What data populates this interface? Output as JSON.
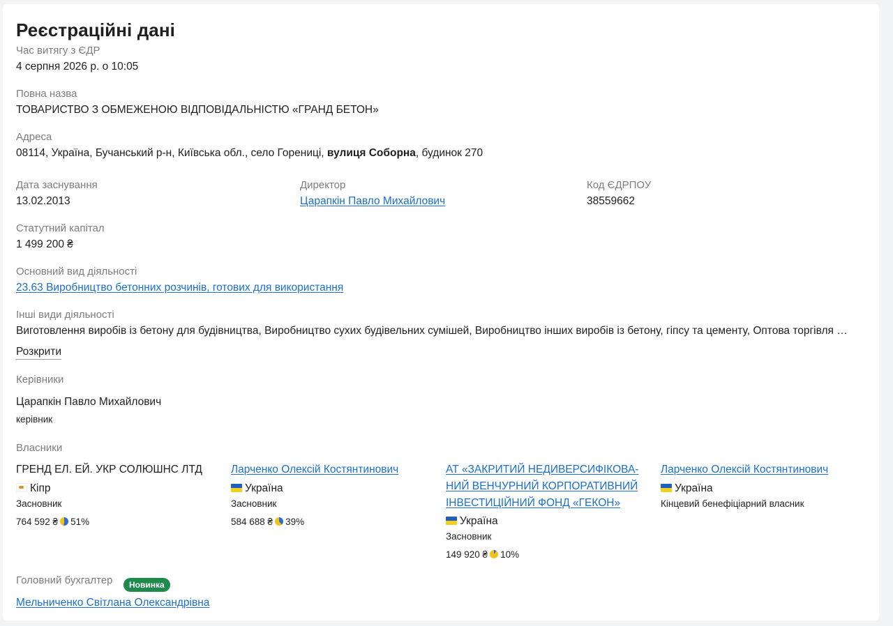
{
  "page": {
    "title": "Реєстраційні дані"
  },
  "extract_time": {
    "label": "Час витягу з ЄДР",
    "value": "4 серпня 2026 р. о 10:05"
  },
  "full_name": {
    "label": "Повна назва",
    "value": "ТОВАРИСТВО З ОБМЕЖЕНОЮ ВІДПОВІДАЛЬНІСТЮ «ГРАНД БЕТОН»"
  },
  "address": {
    "label": "Адреса",
    "prefix": "08114, Україна, Бучанський р-н, Київська обл., село Горениці, ",
    "street": "вулиця Соборна",
    "suffix": ", будинок 270"
  },
  "founded": {
    "label": "Дата заснування",
    "value": "13.02.2013"
  },
  "director": {
    "label": "Директор",
    "value": "Царапкін Павло Михайлович"
  },
  "edrpou": {
    "label": "Код ЄДРПОУ",
    "value": "38559662"
  },
  "capital": {
    "label": "Статутний капітал",
    "value": "1 499 200 ₴"
  },
  "main_activity": {
    "label": "Основний вид діяльності",
    "value": "23.63 Виробництво бетонних розчинів, готових для використання"
  },
  "other_activities": {
    "label": "Інші види діяльності",
    "value": "Виготовлення виробів із бетону для будівництва, Виробництво сухих будівельних сумішей, Виробництво інших виробів із бетону, гіпсу та цементу, Оптова торгівля …",
    "expand_label": "Розкрити"
  },
  "managers": {
    "label": "Керівники",
    "items": [
      {
        "name": "Царапкін Павло Михайлович",
        "role": "керівник"
      }
    ]
  },
  "owners": {
    "label": "Власники",
    "items": [
      {
        "name": "ГРЕНД ЕЛ. ЕЙ. УКР СОЛЮШНС ЛТД",
        "country": "Кіпр",
        "role": "Засновник",
        "amount": "764 592 ₴",
        "share": "51%",
        "share_fraction": 0.51
      },
      {
        "name": "Ларченко Олексій Костянтинович",
        "country": "Україна",
        "role": "Засновник",
        "amount": "584 688 ₴",
        "share": "39%",
        "share_fraction": 0.39
      },
      {
        "name_line1": "АТ «ЗАКРИТИЙ НЕДИВЕРСИФІКОВА-",
        "name_line2": "НИЙ ВЕНЧУРНИЙ КОРПОРАТИВНИЙ",
        "name_line3": "ІНВЕСТИЦІЙНИЙ ФОНД «ГЕКОН»",
        "country": "Україна",
        "role": "Засновник",
        "amount": "149 920 ₴",
        "share": "10%",
        "share_fraction": 0.1
      },
      {
        "name": "Ларченко Олексій Костянтинович",
        "country": "Україна",
        "role": "Кінцевий бенефіціарний власник"
      }
    ]
  },
  "chief_accountant": {
    "label": "Головний бухгалтер",
    "badge": "Новинка",
    "value": "Мельниченко Світлана Олександрівна"
  },
  "colors": {
    "link": "#1a6fd1",
    "label": "#7d7d7d",
    "badge": "#1e8a4c",
    "pie_blue": "#2f6bd8",
    "pie_yellow": "#f2c21b"
  }
}
